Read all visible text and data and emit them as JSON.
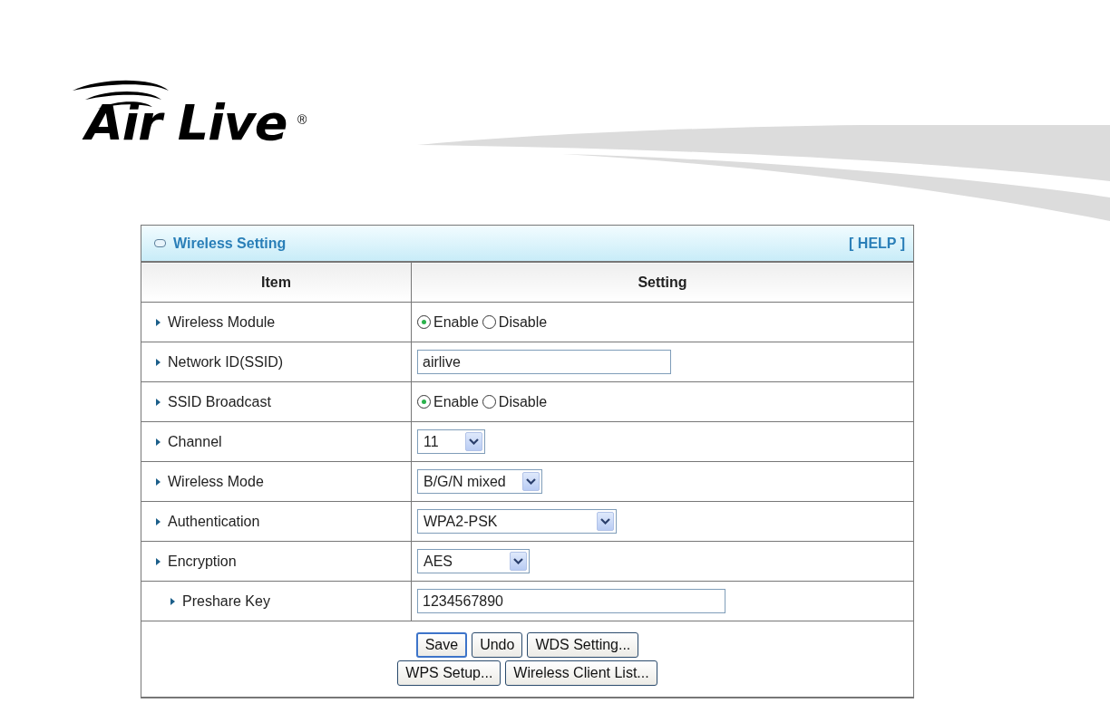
{
  "logo": {
    "text": "Air Live",
    "mark": "®"
  },
  "panel": {
    "title": "Wireless Setting",
    "help": "[ HELP ]"
  },
  "table": {
    "columns": [
      "Item",
      "Setting"
    ],
    "rows": [
      {
        "label": "Wireless Module",
        "kind": "radio",
        "options": [
          {
            "label": "Enable",
            "selected": true
          },
          {
            "label": "Disable",
            "selected": false
          }
        ]
      },
      {
        "label": "Network ID(SSID)",
        "kind": "text",
        "value": "airlive"
      },
      {
        "label": "SSID Broadcast",
        "kind": "radio",
        "options": [
          {
            "label": "Enable",
            "selected": true
          },
          {
            "label": "Disable",
            "selected": false
          }
        ]
      },
      {
        "label": "Channel",
        "kind": "select",
        "value": "11"
      },
      {
        "label": "Wireless Mode",
        "kind": "select",
        "value": "B/G/N mixed"
      },
      {
        "label": "Authentication",
        "kind": "select",
        "value": "WPA2-PSK"
      },
      {
        "label": "Encryption",
        "kind": "select",
        "value": "AES",
        "children": [
          {
            "label": "Preshare Key",
            "kind": "text",
            "value": "1234567890"
          }
        ]
      }
    ]
  },
  "buttons": [
    [
      {
        "label": "Save",
        "focused": true
      },
      {
        "label": "Undo",
        "focused": false
      },
      {
        "label": "WDS Setting...",
        "focused": false
      }
    ],
    [
      {
        "label": "WPS Setup...",
        "focused": false
      },
      {
        "label": "Wireless Client List...",
        "focused": false
      }
    ]
  ]
}
